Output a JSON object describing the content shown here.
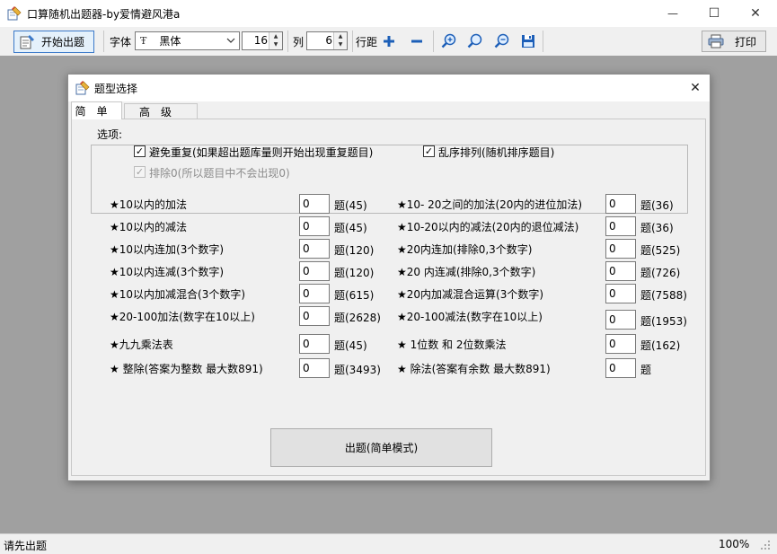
{
  "window": {
    "title": "口算随机出题器-by爱情避风港a",
    "minimize_glyph": "—",
    "maximize_glyph": "☐",
    "close_glyph": "✕"
  },
  "toolbar": {
    "start_label": "开始出题",
    "font_label": "字体",
    "font_name": "黑体",
    "font_size": "16",
    "columns_label": "列",
    "columns_value": "6",
    "line_spacing_label": "行距",
    "print_label": "打印"
  },
  "dialog": {
    "title": "题型选择",
    "close_glyph": "✕",
    "tabs": [
      {
        "label": "简单",
        "active": true
      },
      {
        "label": "高级",
        "active": false
      }
    ],
    "options": {
      "group_label": "选项:",
      "avoid_repeat": "避免重复(如果超出题库量则开始出现重复题目)",
      "shuffle": "乱序排列(随机排序题目)",
      "exclude_zero": "排除0(所以题目中不会出现0)"
    },
    "questions_left": [
      {
        "label": "★10以内的加法",
        "value": "0",
        "count": "题(45)"
      },
      {
        "label": "★10以内的减法",
        "value": "0",
        "count": "题(45)"
      },
      {
        "label": "★10以内连加(3个数字)",
        "value": "0",
        "count": "题(120)"
      },
      {
        "label": "★10以内连减(3个数字)",
        "value": "0",
        "count": "题(120)"
      },
      {
        "label": "★10以内加减混合(3个数字)",
        "value": "0",
        "count": "题(615)"
      },
      {
        "label": "★20-100加法(数字在10以上)",
        "value": "0",
        "count": "题(2628)"
      },
      {
        "label": "★九九乘法表",
        "value": "0",
        "count": "题(45)"
      },
      {
        "label": "★ 整除(答案为整数 最大数891)",
        "value": "0",
        "count": "题(3493)"
      }
    ],
    "questions_right": [
      {
        "label": "★10- 20之间的加法(20内的进位加法)",
        "value": "0",
        "count": "题(36)"
      },
      {
        "label": "★10-20以内的减法(20内的退位减法)",
        "value": "0",
        "count": "题(36)"
      },
      {
        "label": "★20内连加(排除0,3个数字)",
        "value": "0",
        "count": "题(525)"
      },
      {
        "label": "★20 内连减(排除0,3个数字)",
        "value": "0",
        "count": "题(726)"
      },
      {
        "label": "★20内加减混合运算(3个数字)",
        "value": "0",
        "count": "题(7588)"
      },
      {
        "label": "★20-100减法(数字在10以上)",
        "value": "0",
        "count": "题(1953)"
      },
      {
        "label": "★ 1位数 和 2位数乘法",
        "value": "0",
        "count": "题(162)"
      },
      {
        "label": "★ 除法(答案有余数 最大数891)",
        "value": "0",
        "count": "题"
      }
    ],
    "generate_button": "出题(简单模式)"
  },
  "status": {
    "message": "请先出题",
    "zoom": "100%"
  },
  "colors": {
    "accent_blue": "#1d5fb8",
    "workspace_gray": "#a0a0a0"
  }
}
